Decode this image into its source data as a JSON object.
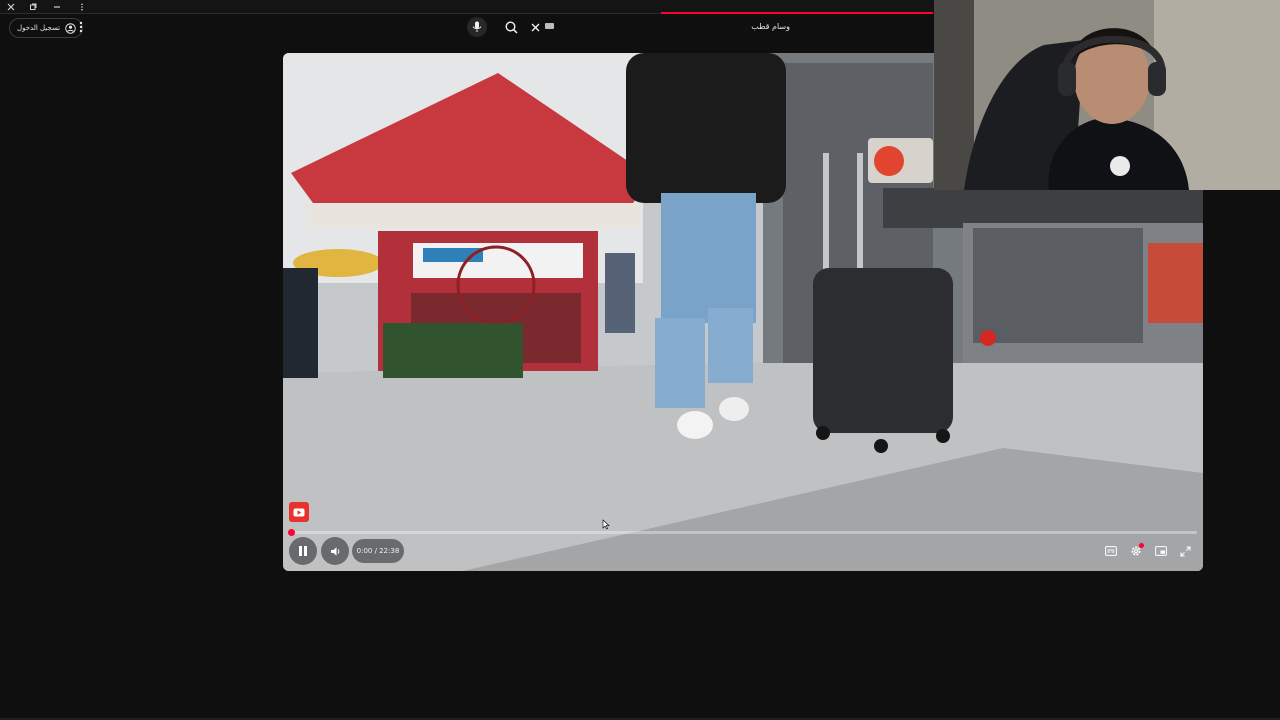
{
  "header": {
    "sign_in_label": "تسجيل الدخول",
    "search_value": "وسام قطب"
  },
  "player": {
    "time": "0:00 / 22:38",
    "progress_fraction": 0.002,
    "state": "playing"
  },
  "icons": {
    "close": "close-icon",
    "restore": "restore-icon",
    "minimize": "minimize-icon",
    "menu": "kebab-menu-icon",
    "account": "account-circle-icon",
    "mic": "mic-icon",
    "search": "search-icon",
    "clear": "close-icon",
    "keyboard": "keyboard-icon",
    "pause": "pause-icon",
    "volume": "volume-icon",
    "subtitles": "subtitles-icon",
    "settings": "settings-icon",
    "miniplayer": "miniplayer-icon",
    "fullscreen": "fullscreen-icon",
    "channel_badge": "subscribe-badge-icon"
  },
  "colors": {
    "background": "#0f0f0f",
    "accent": "#ff0033",
    "text": "#f1f1f1"
  }
}
